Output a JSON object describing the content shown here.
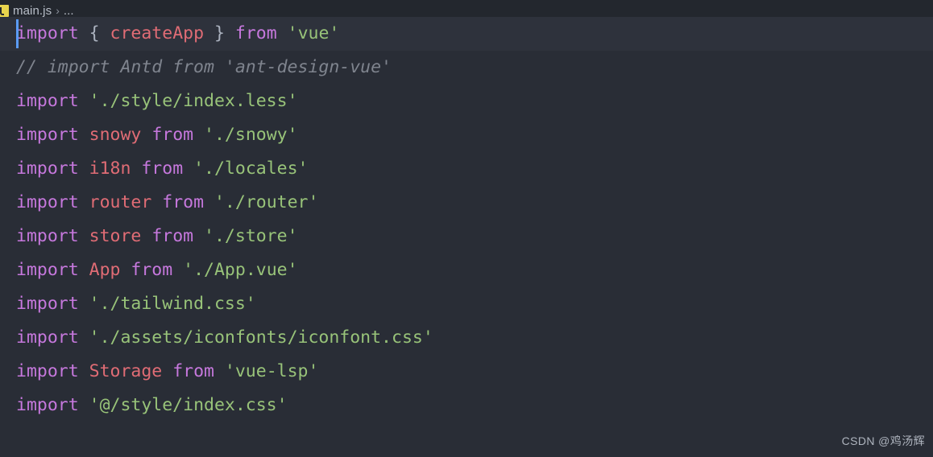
{
  "window": {
    "background_color": "#292d36",
    "active_line_color": "#2e323c",
    "breadcrumb_background": "#23272e"
  },
  "breadcrumb": {
    "file_icon": "javascript-file-icon",
    "file_name": "main.js",
    "separator": "›",
    "overflow_label": "..."
  },
  "theme": {
    "keyword_color": "#c678dd",
    "identifier_color": "#e06c75",
    "string_color": "#98c379",
    "comment_color": "#7f848e",
    "punctuation_color": "#abb2bf",
    "cursor_color": "#5b9cf8"
  },
  "editor": {
    "active_line_index": 0,
    "cursor_line": 1,
    "cursor_column": 1,
    "lines": [
      {
        "active": true,
        "tokens": [
          {
            "t": "import",
            "c": "keyword"
          },
          {
            "t": " ",
            "c": "punct"
          },
          {
            "t": "{",
            "c": "punct"
          },
          {
            "t": " ",
            "c": "punct"
          },
          {
            "t": "createApp",
            "c": "ident"
          },
          {
            "t": " ",
            "c": "punct"
          },
          {
            "t": "}",
            "c": "punct"
          },
          {
            "t": " ",
            "c": "punct"
          },
          {
            "t": "from",
            "c": "keyword"
          },
          {
            "t": " ",
            "c": "punct"
          },
          {
            "t": "'vue'",
            "c": "string"
          }
        ]
      },
      {
        "active": false,
        "tokens": [
          {
            "t": "// import Antd from 'ant-design-vue'",
            "c": "comment"
          }
        ]
      },
      {
        "active": false,
        "tokens": [
          {
            "t": "import",
            "c": "keyword"
          },
          {
            "t": " ",
            "c": "punct"
          },
          {
            "t": "'./style/index.less'",
            "c": "string"
          }
        ]
      },
      {
        "active": false,
        "tokens": [
          {
            "t": "import",
            "c": "keyword"
          },
          {
            "t": " ",
            "c": "punct"
          },
          {
            "t": "snowy",
            "c": "ident"
          },
          {
            "t": " ",
            "c": "punct"
          },
          {
            "t": "from",
            "c": "keyword"
          },
          {
            "t": " ",
            "c": "punct"
          },
          {
            "t": "'./snowy'",
            "c": "string"
          }
        ]
      },
      {
        "active": false,
        "tokens": [
          {
            "t": "import",
            "c": "keyword"
          },
          {
            "t": " ",
            "c": "punct"
          },
          {
            "t": "i18n",
            "c": "ident"
          },
          {
            "t": " ",
            "c": "punct"
          },
          {
            "t": "from",
            "c": "keyword"
          },
          {
            "t": " ",
            "c": "punct"
          },
          {
            "t": "'./locales'",
            "c": "string"
          }
        ]
      },
      {
        "active": false,
        "tokens": [
          {
            "t": "import",
            "c": "keyword"
          },
          {
            "t": " ",
            "c": "punct"
          },
          {
            "t": "router",
            "c": "ident"
          },
          {
            "t": " ",
            "c": "punct"
          },
          {
            "t": "from",
            "c": "keyword"
          },
          {
            "t": " ",
            "c": "punct"
          },
          {
            "t": "'./router'",
            "c": "string"
          }
        ]
      },
      {
        "active": false,
        "tokens": [
          {
            "t": "import",
            "c": "keyword"
          },
          {
            "t": " ",
            "c": "punct"
          },
          {
            "t": "store",
            "c": "ident"
          },
          {
            "t": " ",
            "c": "punct"
          },
          {
            "t": "from",
            "c": "keyword"
          },
          {
            "t": " ",
            "c": "punct"
          },
          {
            "t": "'./store'",
            "c": "string"
          }
        ]
      },
      {
        "active": false,
        "tokens": [
          {
            "t": "import",
            "c": "keyword"
          },
          {
            "t": " ",
            "c": "punct"
          },
          {
            "t": "App",
            "c": "ident"
          },
          {
            "t": " ",
            "c": "punct"
          },
          {
            "t": "from",
            "c": "keyword"
          },
          {
            "t": " ",
            "c": "punct"
          },
          {
            "t": "'./App.vue'",
            "c": "string"
          }
        ]
      },
      {
        "active": false,
        "tokens": [
          {
            "t": "import",
            "c": "keyword"
          },
          {
            "t": " ",
            "c": "punct"
          },
          {
            "t": "'./tailwind.css'",
            "c": "string"
          }
        ]
      },
      {
        "active": false,
        "tokens": [
          {
            "t": "import",
            "c": "keyword"
          },
          {
            "t": " ",
            "c": "punct"
          },
          {
            "t": "'./assets/iconfonts/iconfont.css'",
            "c": "string"
          }
        ]
      },
      {
        "active": false,
        "tokens": [
          {
            "t": "import",
            "c": "keyword"
          },
          {
            "t": " ",
            "c": "punct"
          },
          {
            "t": "Storage",
            "c": "ident"
          },
          {
            "t": " ",
            "c": "punct"
          },
          {
            "t": "from",
            "c": "keyword"
          },
          {
            "t": " ",
            "c": "punct"
          },
          {
            "t": "'vue-lsp'",
            "c": "string"
          }
        ]
      },
      {
        "active": false,
        "tokens": [
          {
            "t": "import",
            "c": "keyword"
          },
          {
            "t": " ",
            "c": "punct"
          },
          {
            "t": "'@/style/index.css'",
            "c": "string"
          }
        ]
      }
    ]
  },
  "watermark": {
    "text": "CSDN @鸡汤辉"
  }
}
